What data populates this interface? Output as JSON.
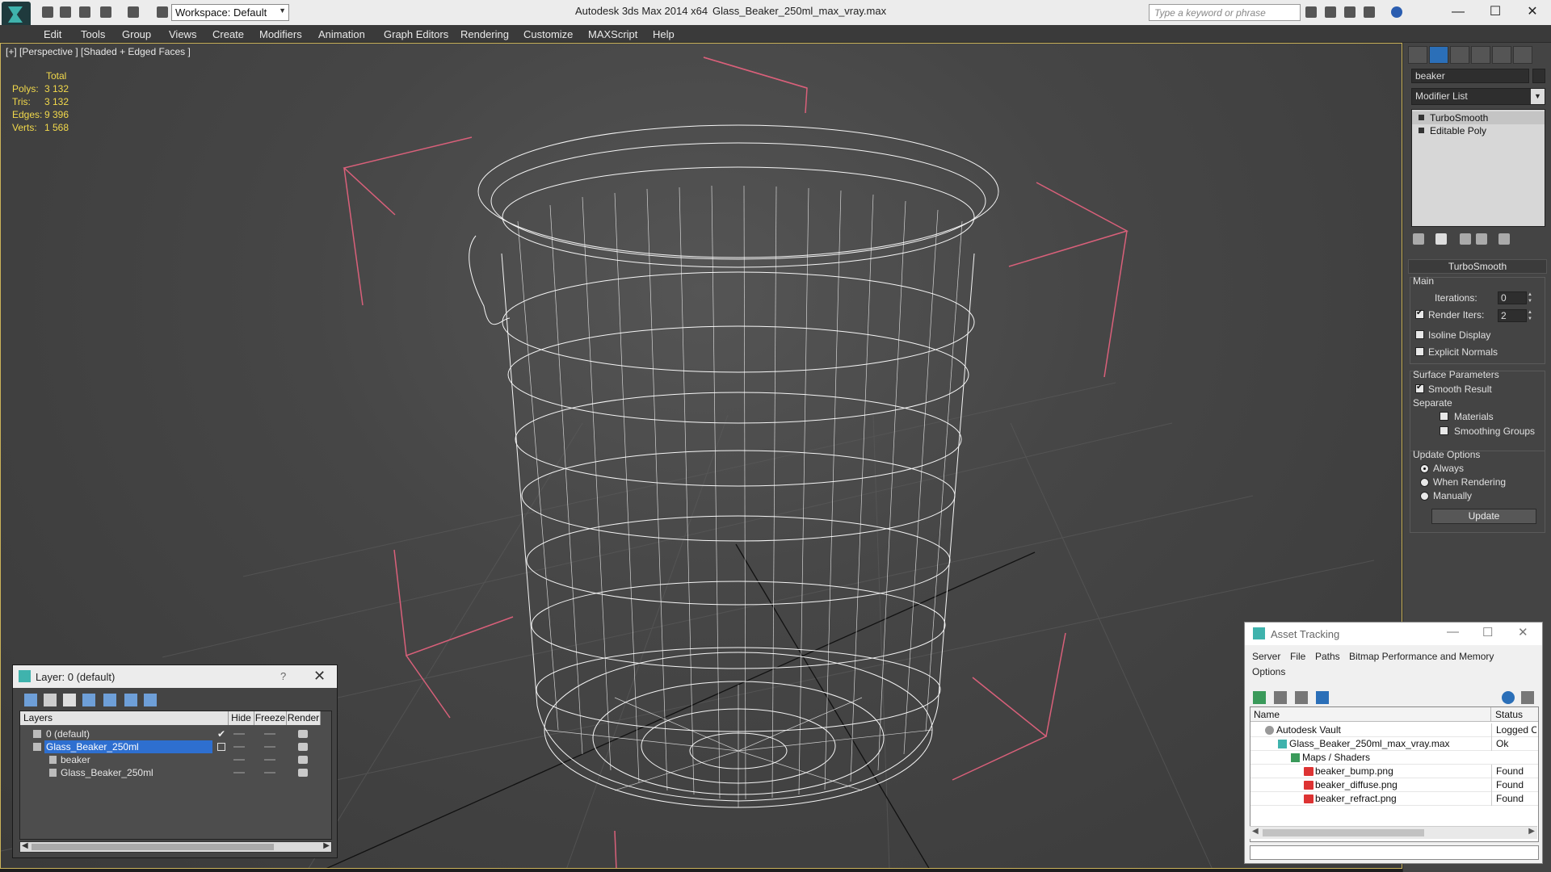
{
  "titlebar": {
    "app_title": "Autodesk 3ds Max 2014 x64",
    "file_name": "Glass_Beaker_250ml_max_vray.max",
    "workspace": "Workspace: Default",
    "search_placeholder": "Type a keyword or phrase",
    "minimize": "—",
    "maximize": "☐",
    "close": "✕"
  },
  "menu": [
    "Edit",
    "Tools",
    "Group",
    "Views",
    "Create",
    "Modifiers",
    "Animation",
    "Graph Editors",
    "Rendering",
    "Customize",
    "MAXScript",
    "Help"
  ],
  "viewport": {
    "label": "[+] [Perspective ] [Shaded + Edged Faces ]",
    "stats": {
      "header": "Total",
      "rows": [
        {
          "key": "Polys:",
          "value": "3 132"
        },
        {
          "key": "Tris:",
          "value": "3 132"
        },
        {
          "key": "Edges:",
          "value": "9 396"
        },
        {
          "key": "Verts:",
          "value": "1 568"
        }
      ]
    }
  },
  "command_panel": {
    "object_name": "beaker",
    "modifier_list": "Modifier List",
    "stack": [
      "TurboSmooth",
      "Editable Poly"
    ],
    "rollout_title": "TurboSmooth",
    "main_label": "Main",
    "iterations_label": "Iterations:",
    "iterations_value": "0",
    "render_iters_label": "Render Iters:",
    "render_iters_value": "2",
    "isoline_label": "Isoline Display",
    "explicit_normals_label": "Explicit Normals",
    "surface_params_label": "Surface Parameters",
    "smooth_result_label": "Smooth Result",
    "separate_label": "Separate",
    "materials_label": "Materials",
    "smoothing_groups_label": "Smoothing Groups",
    "update_options_label": "Update Options",
    "always_label": "Always",
    "when_rendering_label": "When Rendering",
    "manually_label": "Manually",
    "update_button": "Update"
  },
  "layer_dialog": {
    "title": "Layer: 0 (default)",
    "help": "?",
    "close": "✕",
    "columns": [
      "Layers",
      "Hide",
      "Freeze",
      "Render"
    ],
    "rows": [
      {
        "name": "0 (default)",
        "indent": 1,
        "selected": false
      },
      {
        "name": "Glass_Beaker_250ml",
        "indent": 1,
        "selected": true
      },
      {
        "name": "beaker",
        "indent": 2,
        "selected": false
      },
      {
        "name": "Glass_Beaker_250ml",
        "indent": 2,
        "selected": false
      }
    ]
  },
  "asset_dialog": {
    "title": "Asset Tracking",
    "menu": [
      "Server",
      "File",
      "Paths",
      "Bitmap Performance and Memory",
      "Options"
    ],
    "columns": [
      "Name",
      "Status"
    ],
    "rows": [
      {
        "name": "Autodesk Vault",
        "status": "Logged Out"
      },
      {
        "name": "Glass_Beaker_250ml_max_vray.max",
        "status": "Ok"
      },
      {
        "name": "Maps / Shaders",
        "status": ""
      },
      {
        "name": "beaker_bump.png",
        "status": "Found"
      },
      {
        "name": "beaker_diffuse.png",
        "status": "Found"
      },
      {
        "name": "beaker_refract.png",
        "status": "Found"
      }
    ]
  },
  "colors": {
    "viewport_border": "#cbb35a",
    "stats_text": "#f2d94b",
    "selection": "#2e6fd0",
    "wire": "#ffffff",
    "bbox": "#d9607a"
  }
}
